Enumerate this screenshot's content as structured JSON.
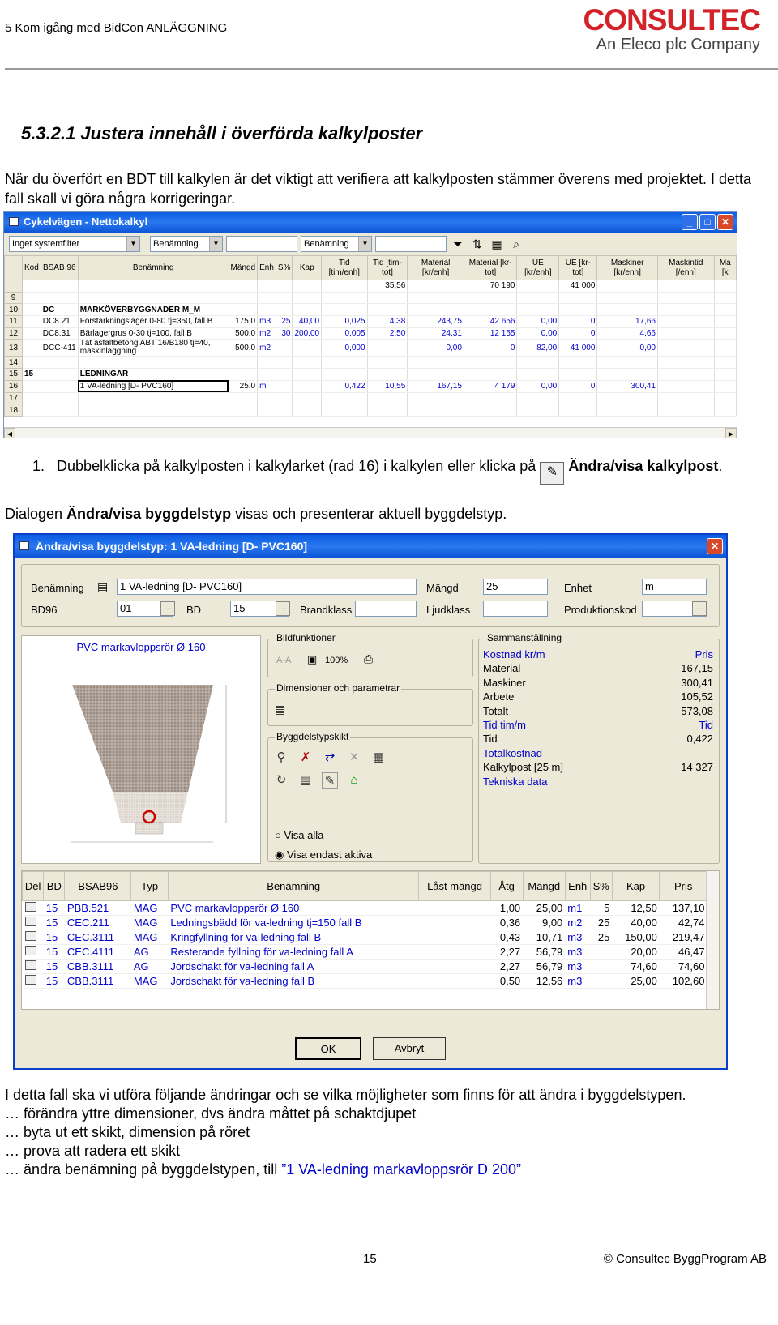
{
  "header": {
    "left": "5 Kom igång med BidCon ANLÄGGNING",
    "logo_top": "CONSULTEC",
    "logo_sub": "An Eleco plc Company"
  },
  "section_title": "5.3.2.1  Justera innehåll i överförda kalkylposter",
  "intro": "När du överfört en BDT till kalkylen är det viktigt att verifiera att kalkylposten stämmer överens med projektet. I detta fall skall vi göra några korrigeringar.",
  "win1": {
    "title": "Cykelvägen - Nettokalkyl",
    "filter1": "Inget systemfilter",
    "filter2": "Benämning",
    "filter3": "Benämning",
    "columns": [
      "Kod",
      "BSAB 96",
      "Benämning",
      "Mängd",
      "Enh",
      "S%",
      "Kap",
      "Tid [tim/enh]",
      "Tid [tim-tot]",
      "Material [kr/enh]",
      "Material [kr-tot]",
      "UE [kr/enh]",
      "UE [kr-tot]",
      "Maskiner [kr/enh]",
      "Maskintid [/enh]",
      "Ma [k"
    ],
    "totals": [
      "",
      "",
      "",
      "",
      "",
      "",
      "",
      "",
      "35,56",
      "",
      "70 190",
      "",
      "41 000",
      "",
      "",
      ""
    ],
    "rows": [
      {
        "n": "9",
        "c": [
          "",
          "",
          "",
          "",
          "",
          "",
          "",
          "",
          "",
          "",
          "",
          "",
          "",
          "",
          "",
          ""
        ]
      },
      {
        "n": "10",
        "c": [
          "",
          "DC",
          "MARKÖVERBYGGNADER M_M",
          "",
          "",
          "",
          "",
          "",
          "",
          "",
          "",
          "",
          "",
          "",
          "",
          ""
        ]
      },
      {
        "n": "11",
        "c": [
          "",
          "DC8.21",
          "Förstärkningslager 0-80 tj=350, fall B",
          "175,0",
          "m3",
          "25",
          "40,00",
          "0,025",
          "4,38",
          "243,75",
          "42 656",
          "0,00",
          "0",
          "17,66",
          "",
          ""
        ]
      },
      {
        "n": "12",
        "c": [
          "",
          "DC8.31",
          "Bärlagergrus 0-30 tj=100, fall B",
          "500,0",
          "m2",
          "30",
          "200,00",
          "0,005",
          "2,50",
          "24,31",
          "12 155",
          "0,00",
          "0",
          "4,66",
          "",
          ""
        ]
      },
      {
        "n": "13",
        "c": [
          "",
          "DCC-411",
          "Tät asfaltbetong ABT 16/B180 tj=40, maskinläggning",
          "500,0",
          "m2",
          "",
          "",
          "0,000",
          "",
          "0,00",
          "0",
          "82,00",
          "41 000",
          "0,00",
          "",
          ""
        ]
      },
      {
        "n": "14",
        "c": [
          "",
          "",
          "",
          "",
          "",
          "",
          "",
          "",
          "",
          "",
          "",
          "",
          "",
          "",
          "",
          ""
        ]
      },
      {
        "n": "15",
        "c": [
          "15",
          "",
          "LEDNINGAR",
          "",
          "",
          "",
          "",
          "",
          "",
          "",
          "",
          "",
          "",
          "",
          "",
          ""
        ]
      },
      {
        "n": "16",
        "c": [
          "",
          "",
          "1 VA-ledning [D- PVC160]",
          "25,0",
          "m",
          "",
          "",
          "0,422",
          "10,55",
          "167,15",
          "4 179",
          "0,00",
          "0",
          "300,41",
          "",
          ""
        ]
      },
      {
        "n": "17",
        "c": [
          "",
          "",
          "",
          "",
          "",
          "",
          "",
          "",
          "",
          "",
          "",
          "",
          "",
          "",
          "",
          ""
        ]
      },
      {
        "n": "18",
        "c": [
          "",
          "",
          "",
          "",
          "",
          "",
          "",
          "",
          "",
          "",
          "",
          "",
          "",
          "",
          "",
          ""
        ]
      }
    ]
  },
  "step": {
    "num": "1.",
    "link": "Dubbelklicka",
    "text": " på kalkylposten i kalkylarket (rad 16) i kalkylen eller klicka på ",
    "bold": "Ändra/visa kalkylpost",
    "end": "."
  },
  "para2": {
    "pre": "Dialogen ",
    "bold": "Ändra/visa byggdelstyp",
    "post": " visas och presenterar aktuell byggdelstyp."
  },
  "dlg": {
    "title": "Ändra/visa byggdelstyp: 1 VA-ledning [D- PVC160]",
    "lbl_ben": "Benämning",
    "val_ben": "1 VA-ledning [D- PVC160]",
    "lbl_mangd": "Mängd",
    "val_mangd": "25",
    "lbl_enhet": "Enhet",
    "val_enhet": "m",
    "lbl_bd96": "BD96",
    "val_bd96": "01",
    "lbl_bd": "BD",
    "val_bd": "15",
    "lbl_brand": "Brandklass",
    "lbl_ljud": "Ljudklass",
    "lbl_prod": "Produktionskod",
    "pic_title": "PVC markavloppsrör Ø 160",
    "g_bild": "Bildfunktioner",
    "bild_zoom": "100%",
    "bild_aa": "A-A",
    "g_dim": "Dimensioner och parametrar",
    "g_skikt": "Byggdelstypskikt",
    "radio1": "Visa alla",
    "radio2": "Visa endast aktiva",
    "g_sum": "Sammanställning",
    "sum": [
      {
        "l": "Kostnad kr/m",
        "v": "Pris",
        "blue": true
      },
      {
        "l": "Material",
        "v": "167,15"
      },
      {
        "l": "Maskiner",
        "v": "300,41"
      },
      {
        "l": "Arbete",
        "v": "105,52"
      },
      {
        "l": "Totalt",
        "v": "573,08"
      },
      {
        "l": "Tid tim/m",
        "v": "Tid",
        "blue": true
      },
      {
        "l": "Tid",
        "v": "0,422"
      },
      {
        "l": "Totalkostnad",
        "v": "",
        "blue": true
      },
      {
        "l": "Kalkylpost [25 m]",
        "v": "14 327"
      },
      {
        "l": "Tekniska data",
        "v": "",
        "blue": true
      }
    ],
    "cols": [
      "Del",
      "BD",
      "BSAB96",
      "Typ",
      "Benämning",
      "Låst mängd",
      "Åtg",
      "Mängd",
      "Enh",
      "S%",
      "Kap",
      "Pris"
    ],
    "rows": [
      [
        "15",
        "PBB.521",
        "MAG",
        "PVC markavloppsrör Ø 160",
        "1,00",
        "25,00",
        "m1",
        "5",
        "12,50",
        "137,10"
      ],
      [
        "15",
        "CEC.211",
        "MAG",
        "Ledningsbädd för va-ledning tj=150 fall B",
        "0,36",
        "9,00",
        "m2",
        "25",
        "40,00",
        "42,74"
      ],
      [
        "15",
        "CEC.3111",
        "MAG",
        "Kringfyllning för va-ledning fall B",
        "0,43",
        "10,71",
        "m3",
        "25",
        "150,00",
        "219,47"
      ],
      [
        "15",
        "CEC.4111",
        "AG",
        "Resterande fyllning för va-ledning fall A",
        "2,27",
        "56,79",
        "m3",
        "",
        "20,00",
        "46,47"
      ],
      [
        "15",
        "CBB.3111",
        "AG",
        "Jordschakt för va-ledning fall A",
        "2,27",
        "56,79",
        "m3",
        "",
        "74,60",
        "74,60"
      ],
      [
        "15",
        "CBB.3111",
        "MAG",
        "Jordschakt för va-ledning fall B",
        "0,50",
        "12,56",
        "m3",
        "",
        "25,00",
        "102,60"
      ]
    ],
    "ok": "OK",
    "cancel": "Avbryt"
  },
  "outro": {
    "l1": "I detta fall ska vi utföra följande ändringar och se vilka möjligheter som finns för att ändra i byggdelstypen.",
    "l2": "… förändra yttre dimensioner, dvs ändra måttet på schaktdjupet",
    "l3": "… byta ut ett skikt, dimension på röret",
    "l4": "… prova att radera ett skikt",
    "l5": "… ändra benämning på byggdelstypen, till ",
    "l5q": "”1 VA-ledning markavloppsrör D 200”"
  },
  "footer": {
    "page": "15",
    "copy": "© Consultec ByggProgram AB"
  }
}
